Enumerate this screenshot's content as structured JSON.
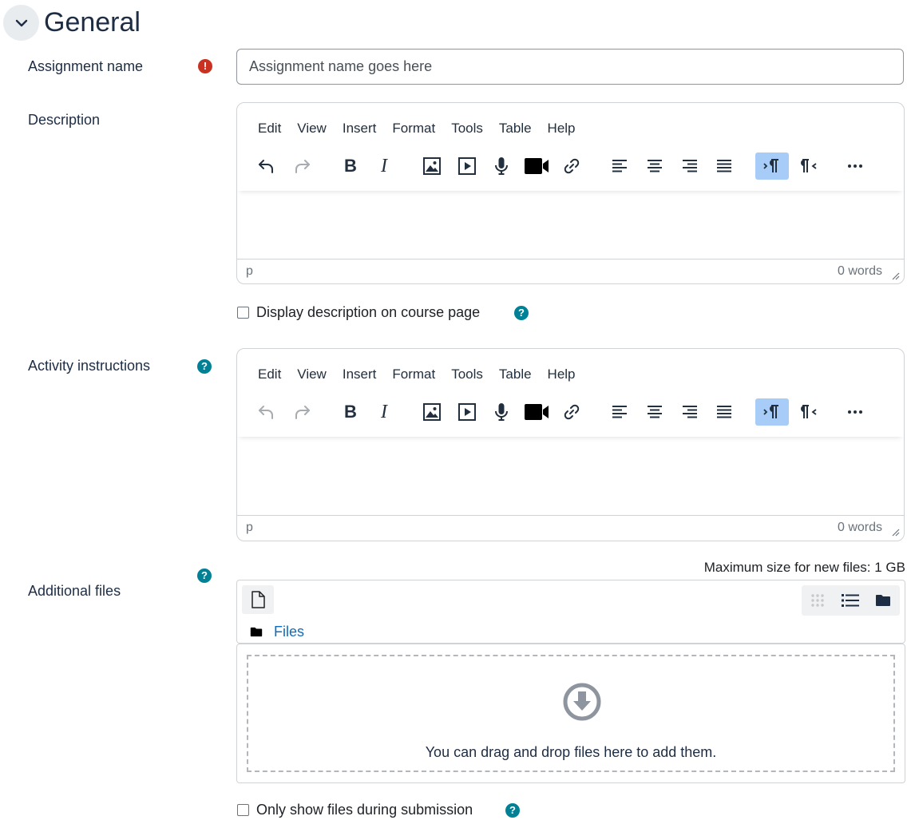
{
  "section": {
    "title": "General"
  },
  "assignment_name": {
    "label": "Assignment name",
    "placeholder": "Assignment name goes here",
    "value": ""
  },
  "description": {
    "label": "Description",
    "menu": [
      "Edit",
      "View",
      "Insert",
      "Format",
      "Tools",
      "Table",
      "Help"
    ],
    "status_path": "p",
    "word_count": "0 words",
    "display_on_course_page_label": "Display description on course page"
  },
  "activity_instructions": {
    "label": "Activity instructions",
    "menu": [
      "Edit",
      "View",
      "Insert",
      "Format",
      "Tools",
      "Table",
      "Help"
    ],
    "status_path": "p",
    "word_count": "0 words"
  },
  "additional_files": {
    "label": "Additional files",
    "max_size": "Maximum size for new files: 1 GB",
    "path_label": "Files",
    "drop_text": "You can drag and drop files here to add them.",
    "only_show_label": "Only show files during submission"
  },
  "colors": {
    "required": "#ca3120",
    "help": "#008196",
    "link": "#0f6cbf",
    "active_tool": "#a6ccf7"
  }
}
